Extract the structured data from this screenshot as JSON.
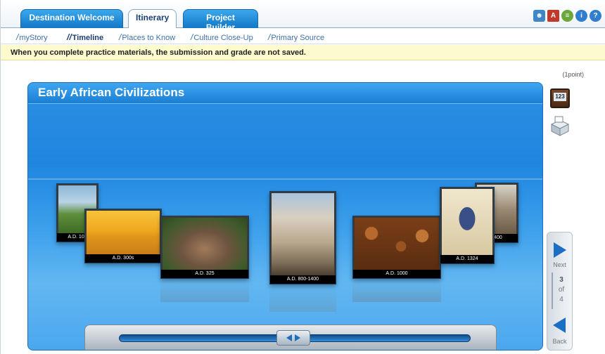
{
  "tabs": [
    {
      "label": "Destination Welcome",
      "active": false
    },
    {
      "label": "Itinerary",
      "active": true
    },
    {
      "label": "Project Builder",
      "active": false
    }
  ],
  "subnav": [
    {
      "label": "myStory",
      "active": false
    },
    {
      "label": "Timeline",
      "active": true
    },
    {
      "label": "Places to Know",
      "active": false
    },
    {
      "label": "Culture Close-Up",
      "active": false
    },
    {
      "label": "Primary Source",
      "active": false
    }
  ],
  "notice": "When you complete practice materials, the submission and grade are not saved.",
  "points": "(1point)",
  "panel": {
    "title": "Early African Civilizations"
  },
  "timeline": [
    {
      "caption": "A.D. 100"
    },
    {
      "caption": "A.D. 300s"
    },
    {
      "caption": "A.D. 325"
    },
    {
      "caption": "A.D. 800-1400"
    },
    {
      "caption": "A.D. 1000"
    },
    {
      "caption": "A.D. 1324"
    },
    {
      "caption": "1400"
    }
  ],
  "tools": {
    "calculator_screen": "123"
  },
  "nav": {
    "next_label": "Next",
    "back_label": "Back",
    "current": "3",
    "of": "of",
    "total": "4"
  },
  "colors": {
    "accent": "#1a6ec3",
    "panel": "#2d8ee3",
    "notice_bg": "#fdfacd"
  }
}
